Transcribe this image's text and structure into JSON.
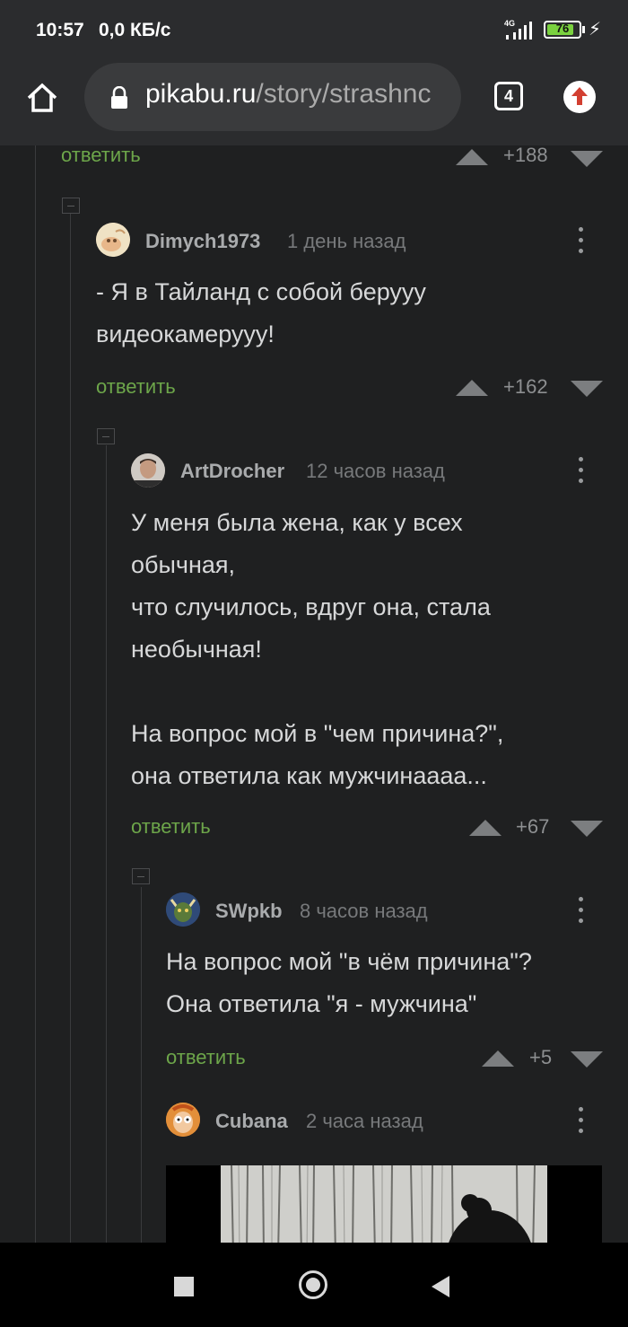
{
  "status_bar": {
    "time": "10:57",
    "net_speed": "0,0 КБ/с",
    "network_type": "4G",
    "battery_percent": "76",
    "icons": [
      "signal-icon",
      "battery-icon",
      "charging-bolt-icon"
    ]
  },
  "browser": {
    "url_domain": "pikabu.ru",
    "url_path": "/story/strashnc",
    "tab_count": "4",
    "icons": [
      "home-icon",
      "lock-icon",
      "tabs-icon",
      "update-arrow-icon"
    ]
  },
  "comments": [
    {
      "partial": true,
      "reply_label": "ответить",
      "score": "+188"
    },
    {
      "username": "Dimych1973",
      "time": "1 день назад",
      "text": "- Я в Тайланд с собой берууу\nвидеокамерууу!",
      "reply_label": "ответить",
      "score": "+162"
    },
    {
      "username": "ArtDrocher",
      "time": "12 часов назад",
      "text": "У меня была жена, как у всех\nобычная,\nчто случилось, вдруг она, стала\nнеобычная!\n\nНа вопрос мой в \"чем причина?\",\nона ответила как мужчинаааа...",
      "reply_label": "ответить",
      "score": "+67"
    },
    {
      "username": "SWpkb",
      "time": "8 часов назад",
      "text": "На вопрос мой \"в чём причина\"?\nОна ответила \"я - мужчина\"",
      "reply_label": "ответить",
      "score": "+5"
    },
    {
      "username": "Cubana",
      "time": "2 часа назад"
    }
  ],
  "colors": {
    "background": "#1f2021",
    "reply_green": "#6da64a",
    "toolbar": "#2b2c2e"
  },
  "nav_bar": {
    "icons": [
      "recents-square-icon",
      "home-circle-icon",
      "back-triangle-icon"
    ]
  }
}
